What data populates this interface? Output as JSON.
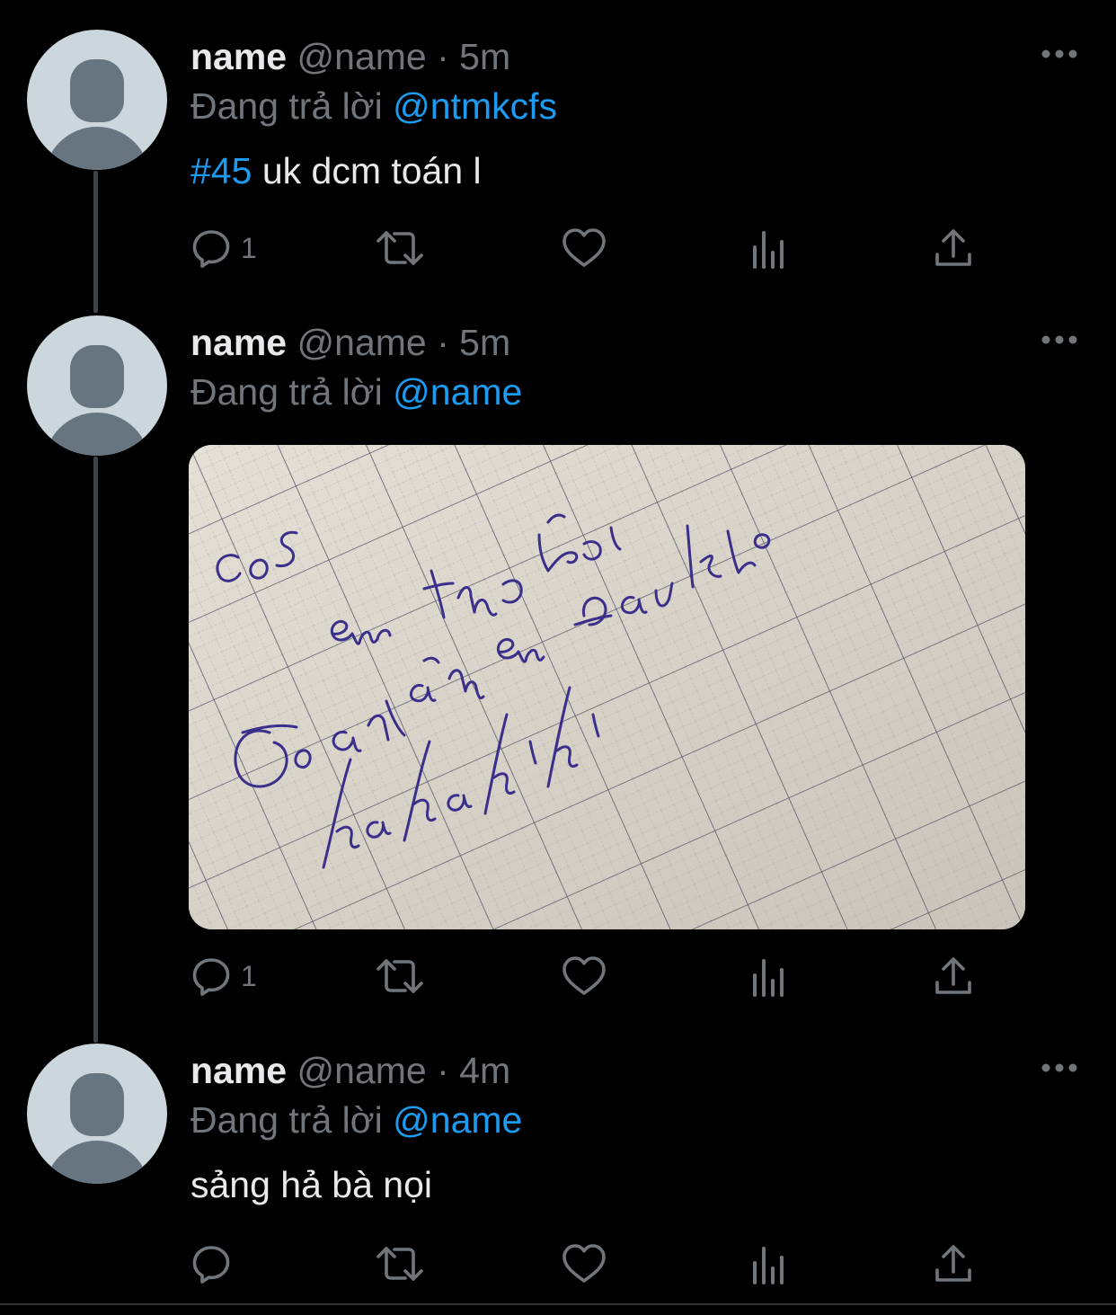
{
  "tweets": [
    {
      "display_name": "name",
      "handle": "@name",
      "separator": "·",
      "time": "5m",
      "reply_prefix": "Đang trả lời",
      "reply_to": "@ntmkcfs",
      "hashtag": "#45",
      "text": "uk dcm toán l",
      "reply_count": "1",
      "has_media": false
    },
    {
      "display_name": "name",
      "handle": "@name",
      "separator": "·",
      "time": "5m",
      "reply_prefix": "Đang trả lời",
      "reply_to": "@name",
      "reply_count": "1",
      "has_media": true,
      "media": {
        "handwriting_lines": [
          "cos",
          "em thua rồi",
          "Toán làm em đau khổ",
          "ha ha hi hi"
        ]
      }
    },
    {
      "display_name": "name",
      "handle": "@name",
      "separator": "·",
      "time": "4m",
      "reply_prefix": "Đang trả lời",
      "reply_to": "@name",
      "text": "sảng hả bà nọi",
      "reply_count": "",
      "has_media": false
    }
  ],
  "icons": {
    "reply": "reply-icon",
    "retweet": "retweet-icon",
    "like": "heart-icon",
    "views": "analytics-icon",
    "share": "share-icon",
    "more": "more-dots-icon"
  },
  "colors": {
    "background": "#000000",
    "text": "#e7e9ea",
    "muted": "#71767b",
    "link": "#1d9bf0",
    "thread_line": "#3d4247",
    "avatar_bg": "#ccd6dd",
    "avatar_fg": "#66757f",
    "ink": "#3a2f8a"
  }
}
